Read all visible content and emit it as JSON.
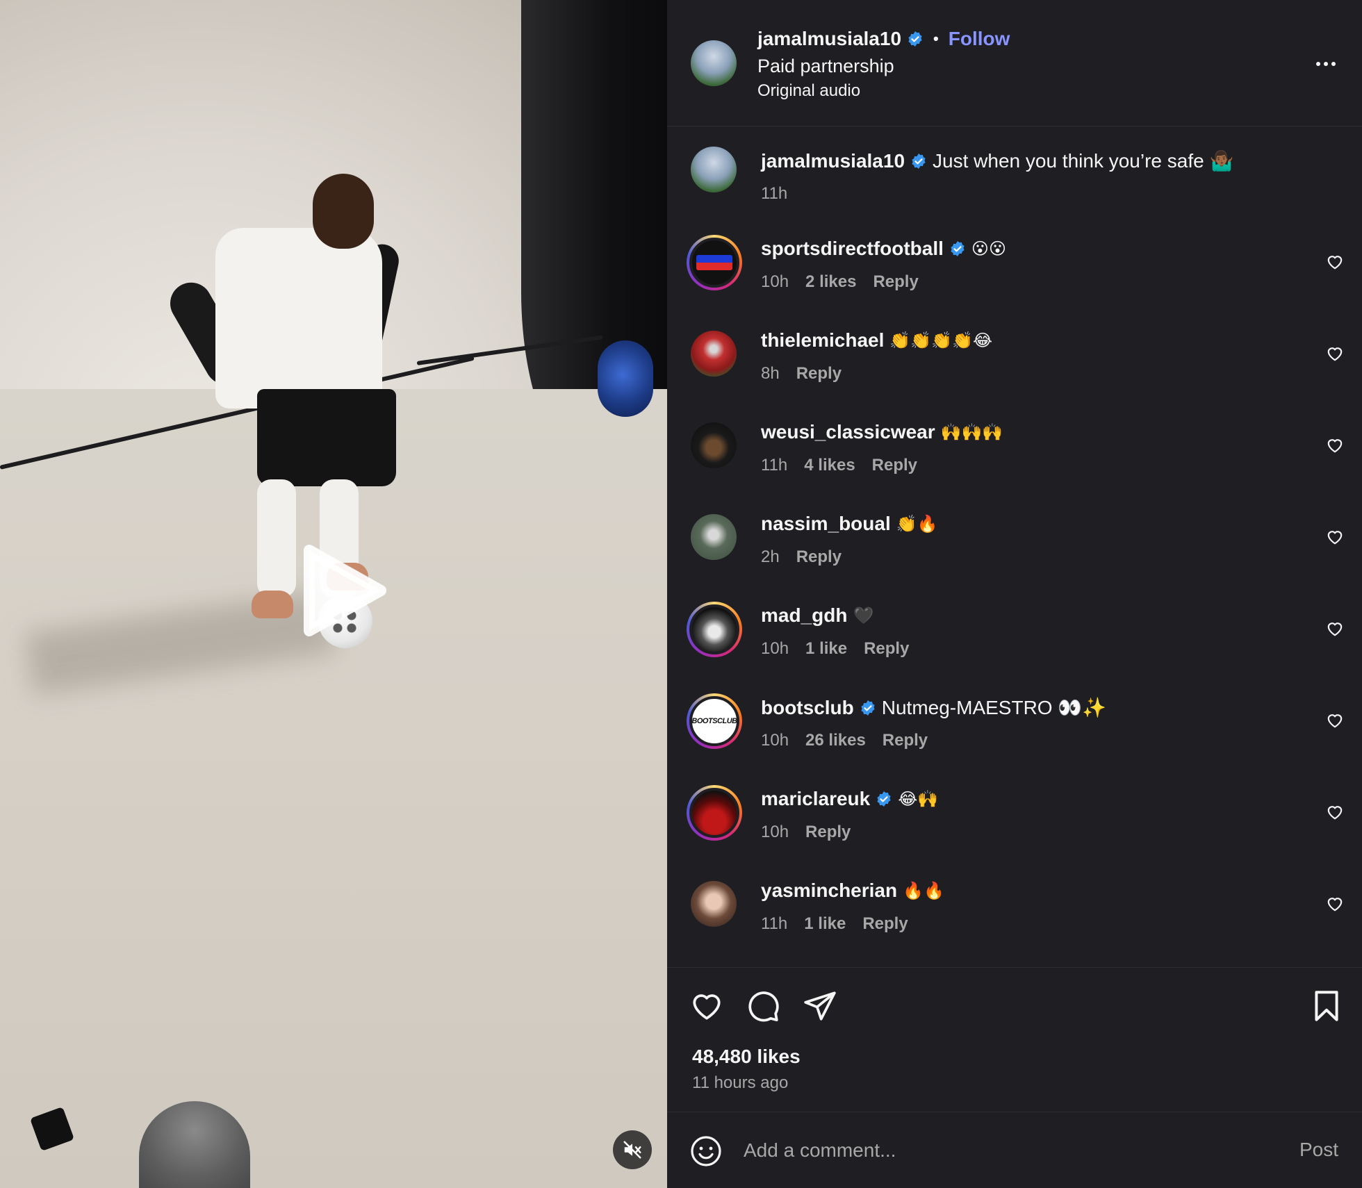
{
  "post": {
    "author": "jamalmusiala10",
    "follow_label": "Follow",
    "separator": "•",
    "subtitle": "Paid partnership",
    "audio": "Original audio",
    "caption": {
      "user": "jamalmusiala10",
      "text": "Just when you think you’re safe 🤷🏾‍♂️",
      "time": "11h"
    }
  },
  "comments": [
    {
      "user": "sportsdirectfootball",
      "verified": true,
      "text": "😮😮",
      "time": "10h",
      "likes": "2 likes",
      "reply": "Reply"
    },
    {
      "user": "thielemichael",
      "verified": false,
      "text": "👏👏👏👏😂",
      "time": "8h",
      "likes": "",
      "reply": "Reply"
    },
    {
      "user": "weusi_classicwear",
      "verified": false,
      "text": "🙌🙌🙌",
      "time": "11h",
      "likes": "4 likes",
      "reply": "Reply"
    },
    {
      "user": "nassim_boual",
      "verified": false,
      "text": "👏🔥",
      "time": "2h",
      "likes": "",
      "reply": "Reply"
    },
    {
      "user": "mad_gdh",
      "verified": false,
      "text": "🖤",
      "time": "10h",
      "likes": "1 like",
      "reply": "Reply"
    },
    {
      "user": "bootsclub",
      "verified": true,
      "text": "Nutmeg-MAESTRO 👀✨",
      "time": "10h",
      "likes": "26 likes",
      "reply": "Reply"
    },
    {
      "user": "mariclareuk",
      "verified": true,
      "text": "😂🙌",
      "time": "10h",
      "likes": "",
      "reply": "Reply"
    },
    {
      "user": "yasmincherian",
      "verified": false,
      "text": "🔥🔥",
      "time": "11h",
      "likes": "1 like",
      "reply": "Reply"
    }
  ],
  "avatar_labels": {
    "bootsclub": "BOOTSCLUB"
  },
  "stats": {
    "likes": "48,480 likes",
    "time_ago": "11 hours ago"
  },
  "composer": {
    "placeholder": "Add a comment...",
    "post_label": "Post"
  },
  "icons": [
    "play-icon",
    "mute-icon",
    "more-icon",
    "verified-icon",
    "heart-icon",
    "comment-icon",
    "share-icon",
    "bookmark-icon",
    "smiley-icon"
  ],
  "colors": {
    "panel_bg": "#1f1f23",
    "accent": "#8894ff",
    "verified": "#3897f0",
    "muted_text": "#a8a8a8"
  }
}
